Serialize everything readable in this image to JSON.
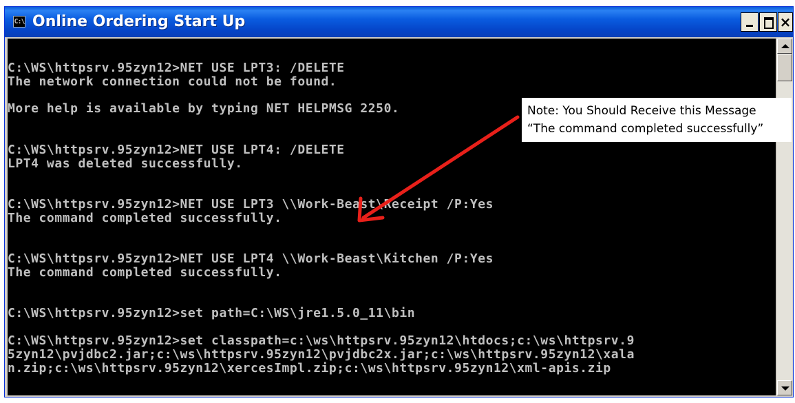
{
  "window": {
    "title": "Online Ordering Start Up",
    "icon_text": "C:\\",
    "icon": "console-app-icon",
    "buttons": {
      "minimize": "minimize-icon",
      "maximize": "maximize-icon",
      "close": "×"
    }
  },
  "console": {
    "lines": [
      "C:\\WS\\httpsrv.95zyn12>NET USE LPT3: /DELETE",
      "The network connection could not be found.",
      "",
      "More help is available by typing NET HELPMSG 2250.",
      "",
      "",
      "C:\\WS\\httpsrv.95zyn12>NET USE LPT4: /DELETE",
      "LPT4 was deleted successfully.",
      "",
      "",
      "C:\\WS\\httpsrv.95zyn12>NET USE LPT3 \\\\Work-Beast\\Receipt /P:Yes",
      "The command completed successfully.",
      "",
      "",
      "C:\\WS\\httpsrv.95zyn12>NET USE LPT4 \\\\Work-Beast\\Kitchen /P:Yes",
      "The command completed successfully.",
      "",
      "",
      "C:\\WS\\httpsrv.95zyn12>set path=C:\\WS\\jre1.5.0_11\\bin",
      "",
      "C:\\WS\\httpsrv.95zyn12>set classpath=c:\\ws\\httpsrv.95zyn12\\htdocs;c:\\ws\\httpsrv.9",
      "5zyn12\\pvjdbc2.jar;c:\\ws\\httpsrv.95zyn12\\pvjdbc2x.jar;c:\\ws\\httpsrv.95zyn12\\xala",
      "n.zip;c:\\ws\\httpsrv.95zyn12\\xercesImpl.zip;c:\\ws\\httpsrv.95zyn12\\xml-apis.zip"
    ],
    "text_color": "#c0c0c0",
    "background": "#000000"
  },
  "annotation": {
    "note": "Note: You Should Receive this Message “The command completed successfully”",
    "arrow_color": "#e8201a"
  }
}
